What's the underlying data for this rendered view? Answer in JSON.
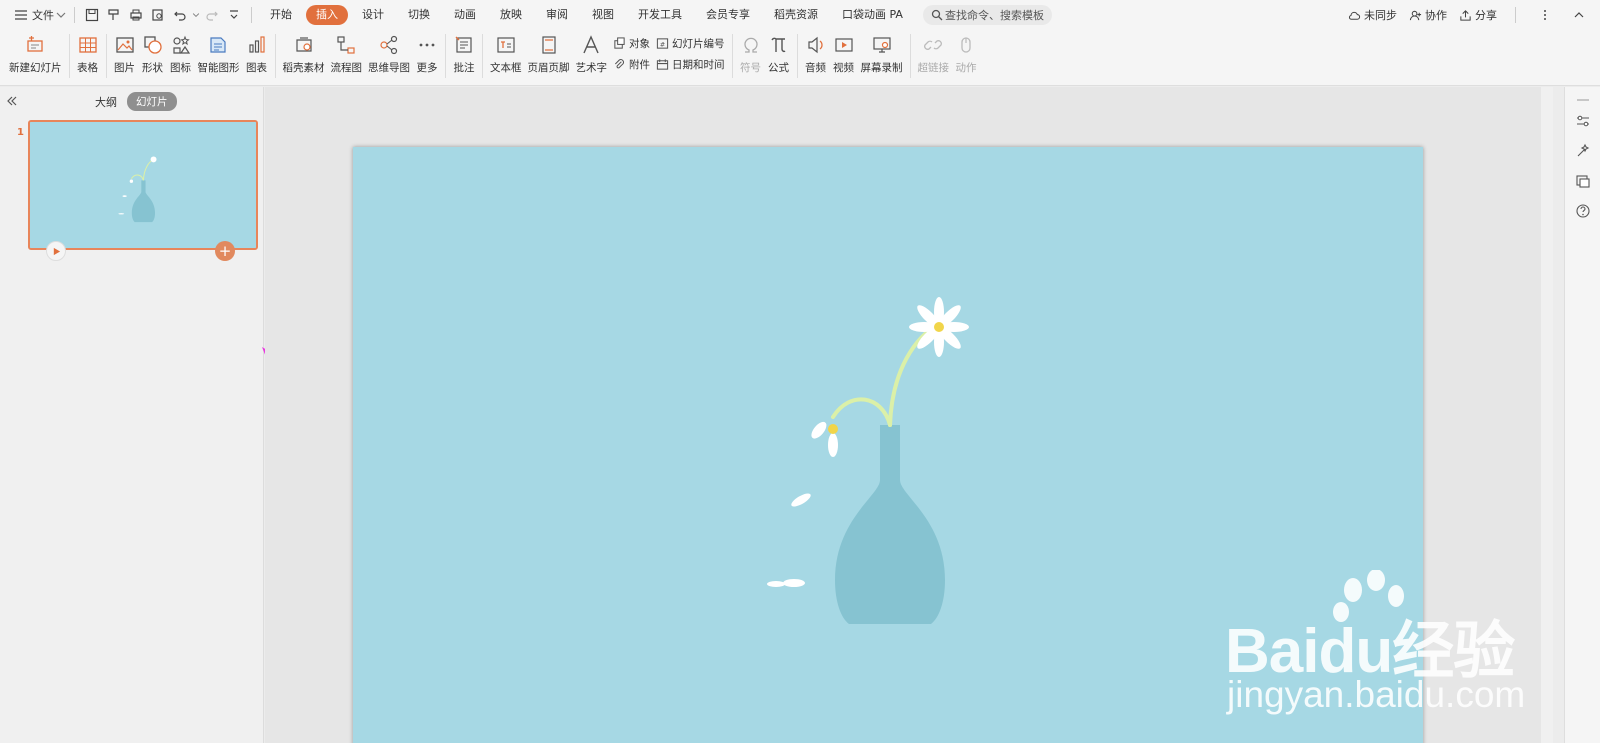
{
  "menu": {
    "file_label": "文件",
    "tabs": [
      {
        "label": "开始",
        "active": false
      },
      {
        "label": "插入",
        "active": true
      },
      {
        "label": "设计",
        "active": false
      },
      {
        "label": "切换",
        "active": false
      },
      {
        "label": "动画",
        "active": false
      },
      {
        "label": "放映",
        "active": false
      },
      {
        "label": "审阅",
        "active": false
      },
      {
        "label": "视图",
        "active": false
      },
      {
        "label": "开发工具",
        "active": false
      },
      {
        "label": "会员专享",
        "active": false
      },
      {
        "label": "稻壳资源",
        "active": false
      },
      {
        "label": "口袋动画 PA",
        "active": false
      }
    ],
    "search_placeholder": "查找命令、搜索模板",
    "sync_label": "未同步",
    "collab_label": "协作",
    "share_label": "分享"
  },
  "ribbon": {
    "new_slide": "新建幻灯片",
    "table": "表格",
    "picture": "图片",
    "shape": "形状",
    "icon": "图标",
    "smart_graphic": "智能图形",
    "chart": "图表",
    "docer_material": "稻壳素材",
    "flowchart": "流程图",
    "mindmap": "思维导图",
    "more": "更多",
    "comment": "批注",
    "textbox": "文本框",
    "header_footer": "页眉页脚",
    "wordart": "艺术字",
    "object": "对象",
    "attachment": "附件",
    "slide_number": "幻灯片编号",
    "date_time": "日期和时间",
    "symbol": "符号",
    "formula": "公式",
    "audio": "音频",
    "video": "视频",
    "screen_record": "屏幕录制",
    "hyperlink": "超链接",
    "action": "动作"
  },
  "panel": {
    "outline_tab": "大纲",
    "slides_tab": "幻灯片",
    "slide_number": "1"
  },
  "watermark": {
    "brand": "Baidu经验",
    "url": "jingyan.baidu.com"
  },
  "colors": {
    "accent": "#e1703d",
    "slide_bg": "#a6d8e4",
    "vase": "#86c3d1",
    "stem": "#dbf0a8",
    "arrow": "#e93ae0"
  }
}
